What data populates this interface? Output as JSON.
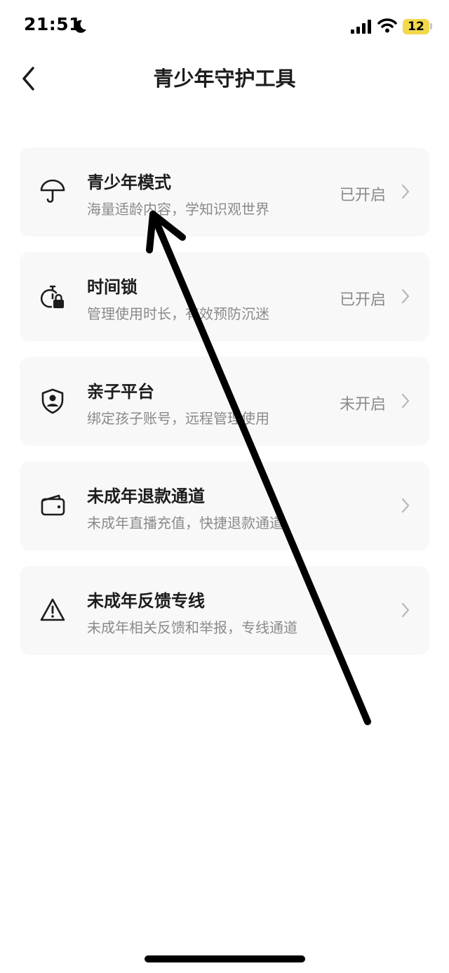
{
  "status_bar": {
    "time": "21:51",
    "battery": "12",
    "icons": [
      "moon-icon",
      "signal-icon",
      "wifi-icon",
      "battery-icon"
    ]
  },
  "nav": {
    "title": "青少年守护工具",
    "back_icon": "chevron-left-icon"
  },
  "items": [
    {
      "title": "青少年模式",
      "subtitle": "海量适龄内容，学知识观世界",
      "status": "已开启",
      "icon": "umbrella-icon"
    },
    {
      "title": "时间锁",
      "subtitle": "管理使用时长，有效预防沉迷",
      "status": "已开启",
      "icon": "timer-lock-icon"
    },
    {
      "title": "亲子平台",
      "subtitle": "绑定孩子账号，远程管理使用",
      "status": "未开启",
      "icon": "shield-person-icon"
    },
    {
      "title": "未成年退款通道",
      "subtitle": "未成年直播充值，快捷退款通道",
      "status": "",
      "icon": "wallet-icon"
    },
    {
      "title": "未成年反馈专线",
      "subtitle": "未成年相关反馈和举报，专线通道",
      "status": "",
      "icon": "warning-icon"
    }
  ],
  "colors": {
    "background": "#ffffff",
    "card": "#f8f8f8",
    "text_primary": "#1c1c1e",
    "text_secondary": "#8a8a8e",
    "battery": "#f2d94a",
    "annotation_arrow": "#000000"
  }
}
